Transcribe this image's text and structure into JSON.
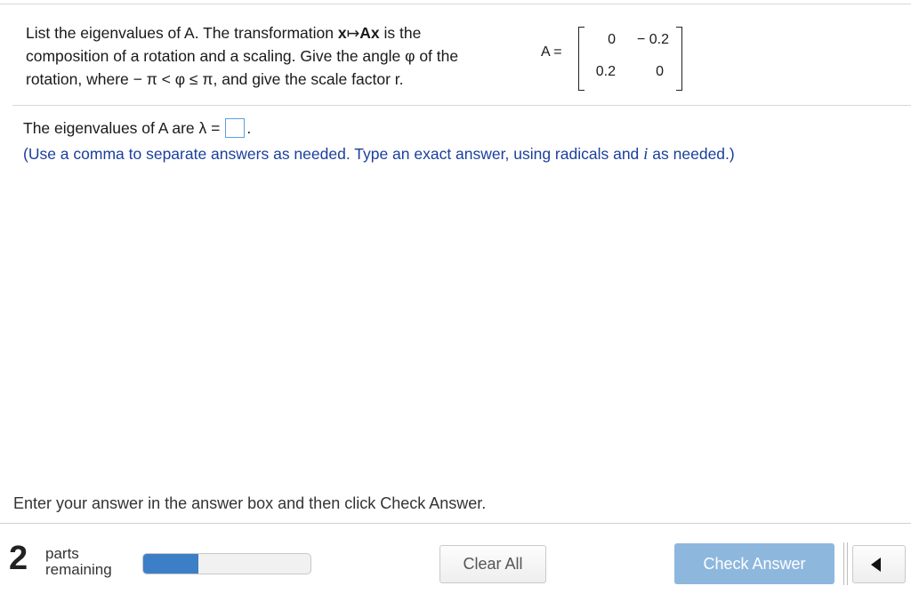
{
  "question": {
    "part1": "List the eigenvalues of A. The transformation ",
    "x": "x",
    "arrow": "↦",
    "Ax": "Ax",
    "part2": " is the composition of a rotation and a scaling. Give the angle ",
    "phi": "φ",
    "part3": " of the rotation, where ",
    "constraint": "− π < φ ≤ π",
    "part4": ", and give the scale factor r."
  },
  "matrix": {
    "label": "A =",
    "cells": [
      [
        "0",
        "− 0.2"
      ],
      [
        "0.2",
        "0"
      ]
    ]
  },
  "answer": {
    "prefix": "The eigenvalues of A are λ =",
    "suffix": ".",
    "value": ""
  },
  "hint": {
    "part1": "(Use a comma to separate answers as needed. Type an exact answer, using radicals and ",
    "i": "i",
    "part2": " as needed.)"
  },
  "instruction": "Enter your answer in the answer box and then click Check Answer.",
  "footer": {
    "parts_count": "2",
    "parts_word": "parts",
    "remaining_word": "remaining",
    "progress_fraction": 0.33,
    "clear_label": "Clear All",
    "check_label": "Check Answer",
    "prev_icon": "triangle-left-icon"
  },
  "colors": {
    "hint_text": "#1b3f9c",
    "progress_fill": "#3d7fc6",
    "check_button": "#8eb7de",
    "answer_box_border": "#5ea0dc"
  }
}
